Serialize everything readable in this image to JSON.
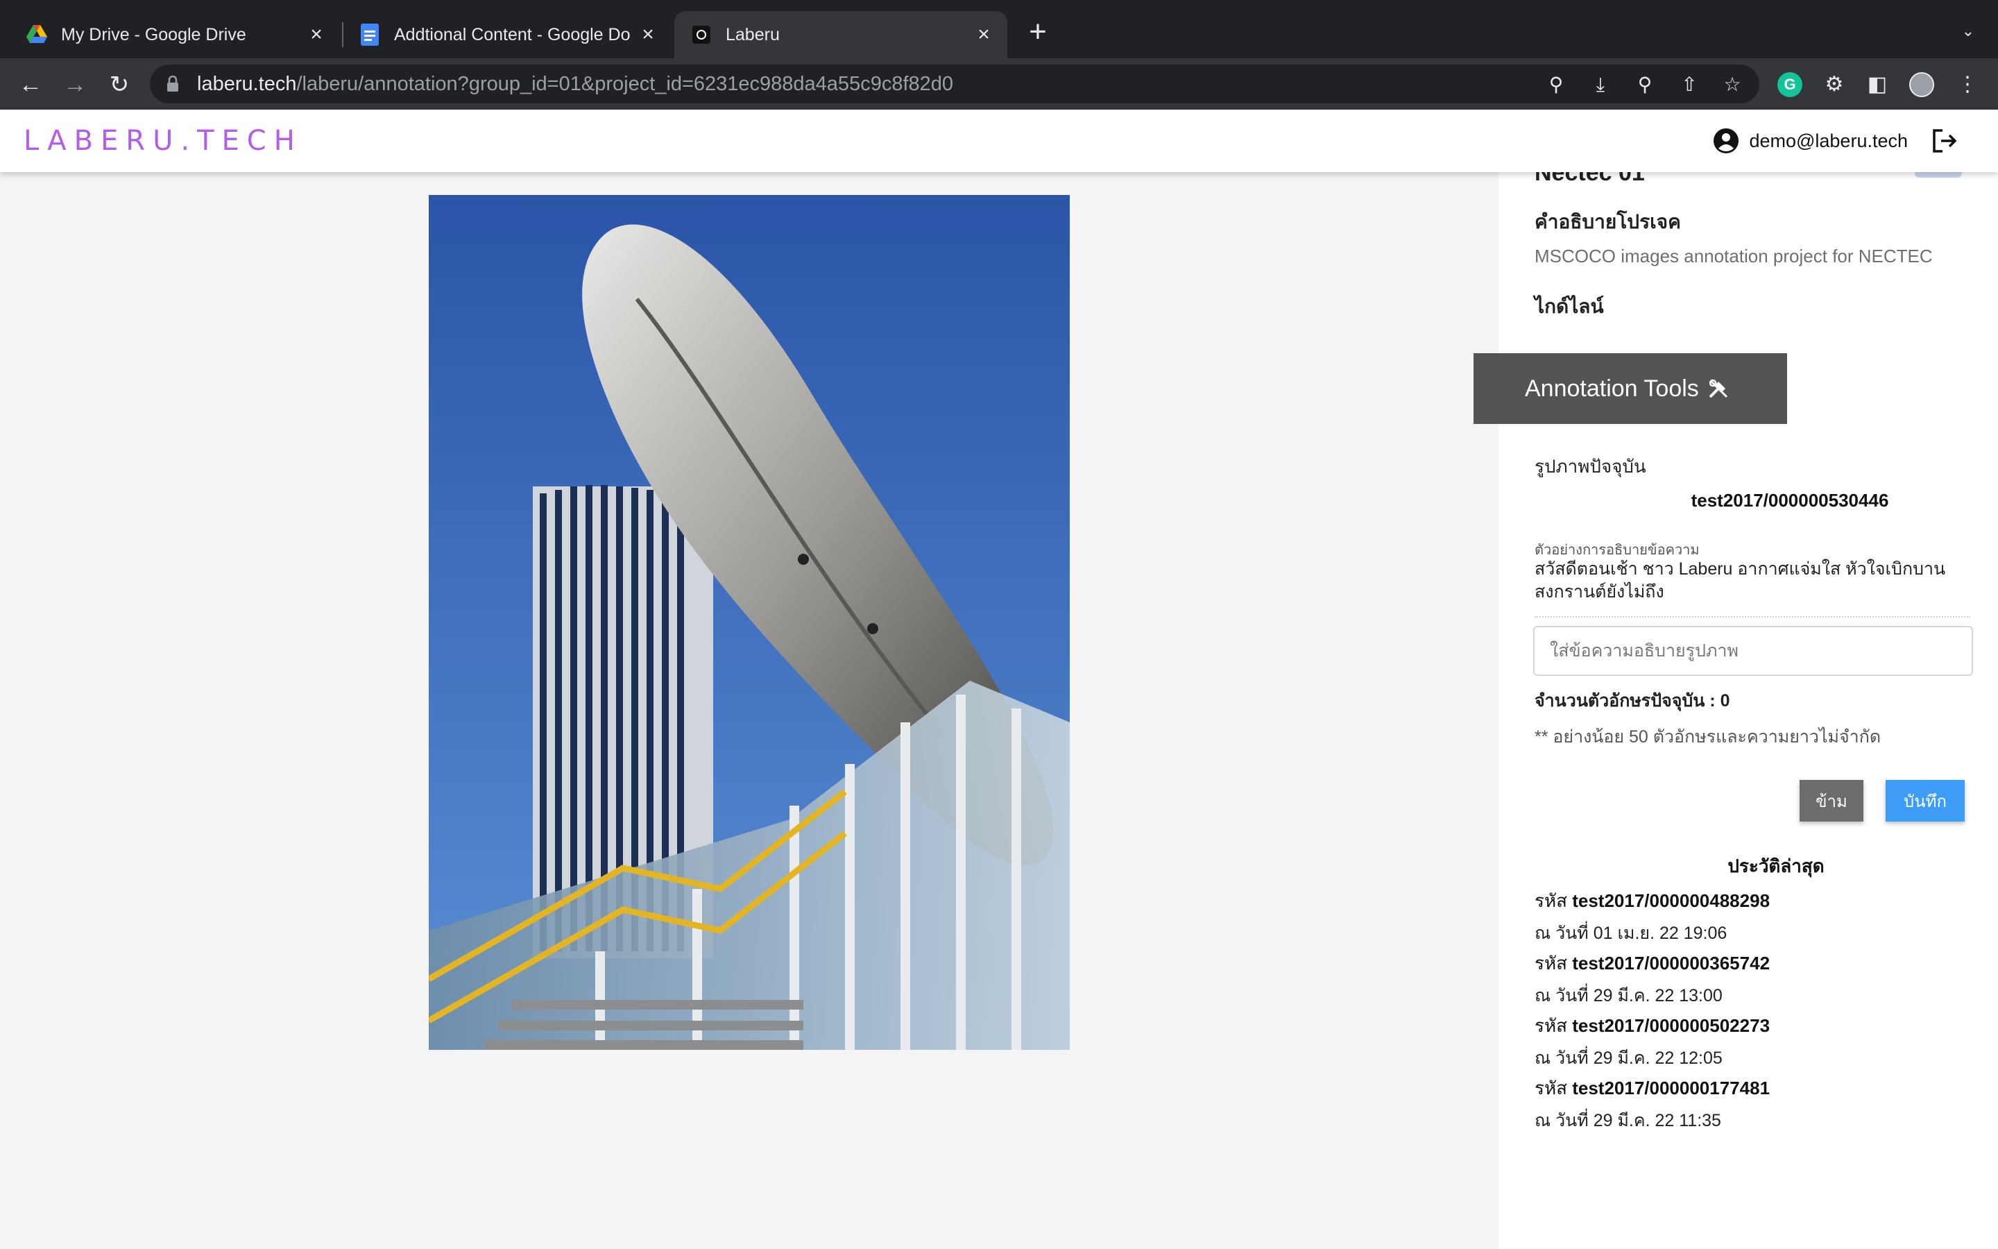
{
  "browser": {
    "tabs": [
      {
        "title": "My Drive - Google Drive",
        "icon": "google-drive-icon",
        "active": false
      },
      {
        "title": "Addtional Content - Google Do",
        "icon": "google-docs-icon",
        "active": false
      },
      {
        "title": "Laberu",
        "icon": "laberu-favicon",
        "active": true
      }
    ],
    "url_host": "laberu.tech",
    "url_path": "/laberu/annotation?group_id=01&project_id=6231ec988da4a55c9c8f82d0"
  },
  "header": {
    "logo": "LABERU.TECH",
    "user_email": "demo@laberu.tech"
  },
  "project": {
    "title_partial": "Nectec 01",
    "description_heading": "คำอธิบายโปรเจค",
    "description": "MSCOCO images annotation project for NECTEC",
    "guideline_heading": "ไกด์ไลน์"
  },
  "annotation": {
    "tools_label": "Annotation Tools",
    "current_image_label": "รูปภาพปัจจุบัน",
    "current_image_id": "test2017/000000530446",
    "example_label": "ตัวอย่างการอธิบายข้อความ",
    "example_text": "สวัสดีตอนเช้า ชาว Laberu อากาศแจ่มใส หัวใจเบิกบาน สงกรานต์ยังไม่ถึง",
    "input_placeholder": "ใส่ข้อความอธิบายรูปภาพ",
    "input_value": "",
    "char_count_label": "จำนวนตัวอักษรปัจจุบัน : ",
    "char_count": "0",
    "note": "** อย่างน้อย 50 ตัวอักษรและความยาวไม่จำกัด",
    "skip_label": "ข้าม",
    "save_label": "บันทึก"
  },
  "history": {
    "title": "ประวัติล่าสุด",
    "id_prefix": "รหัส ",
    "items": [
      {
        "id": "test2017/000000488298",
        "date": "ณ วันที่ 01 เม.ย. 22 19:06"
      },
      {
        "id": "test2017/000000365742",
        "date": "ณ วันที่ 29 มี.ค. 22 13:00"
      },
      {
        "id": "test2017/000000502273",
        "date": "ณ วันที่ 29 มี.ค. 22 12:05"
      },
      {
        "id": "test2017/000000177481",
        "date": "ณ วันที่ 29 มี.ค. 22 11:35"
      }
    ]
  },
  "colors": {
    "logo": "#b35ee6",
    "tools_button": "#545454",
    "save_button": "#3d9cf5",
    "skip_button": "#6c6c6c",
    "sky": "#2f5fb4"
  }
}
